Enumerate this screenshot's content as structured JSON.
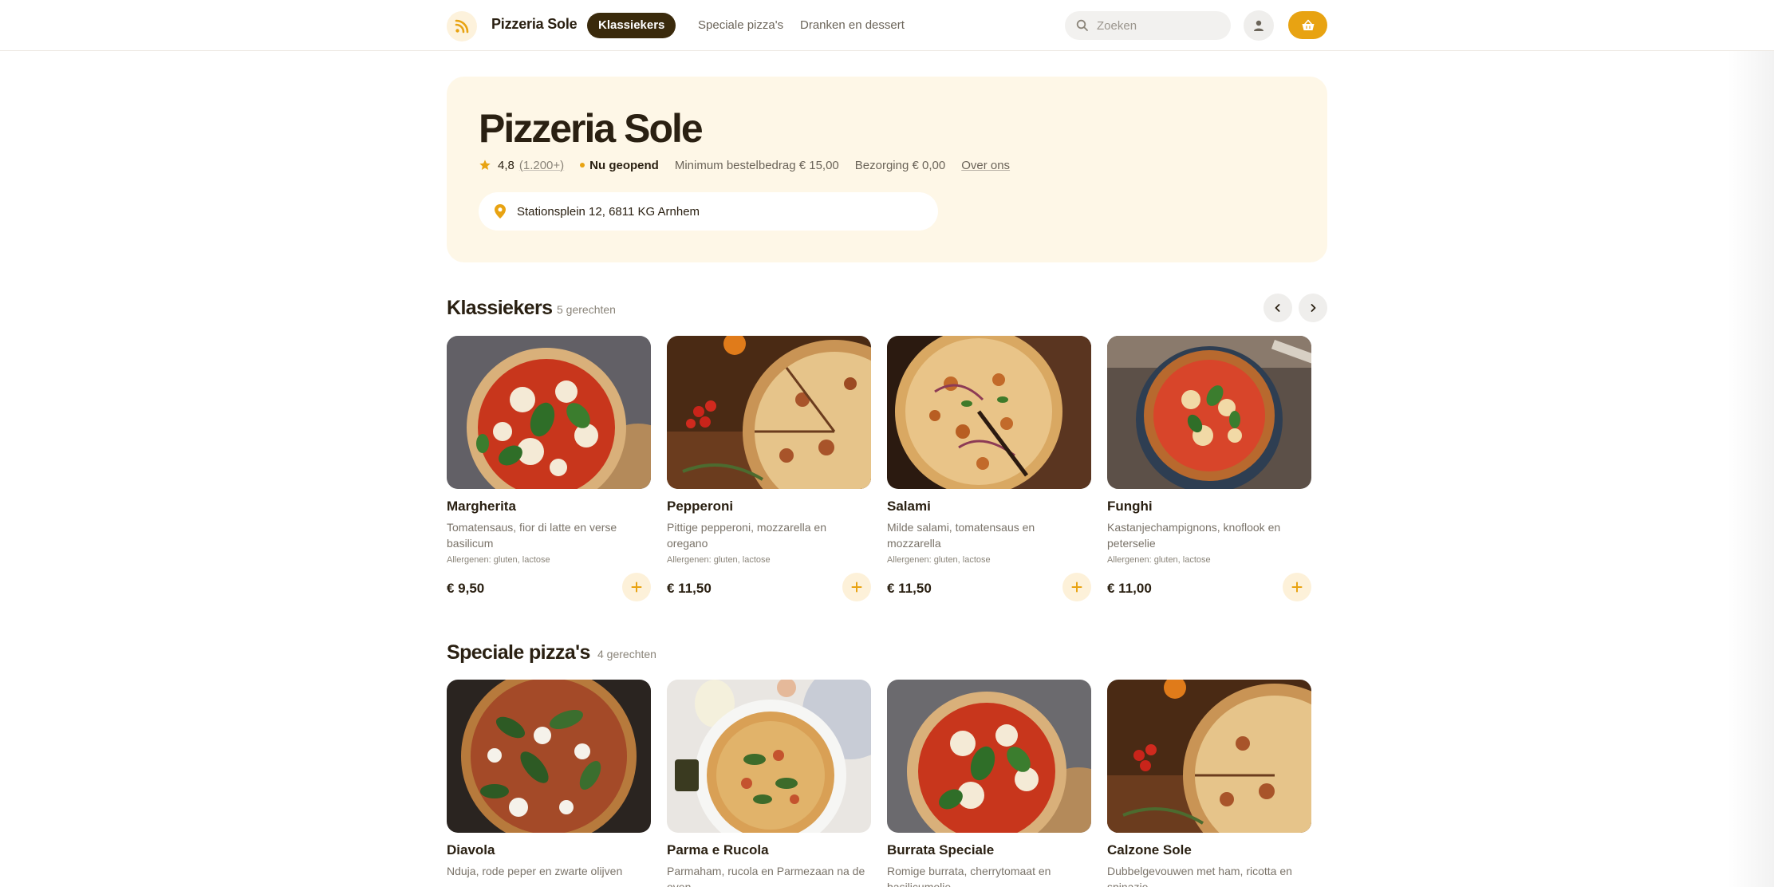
{
  "header": {
    "brand": "Pizzeria Sole",
    "nav": [
      "Klassiekers",
      "Speciale pizza's",
      "Dranken en dessert"
    ],
    "search_placeholder": "Zoeken"
  },
  "hero": {
    "title": "Pizzeria Sole",
    "rating": "4,8",
    "rating_count": "(1.200+)",
    "status": "Nu geopend",
    "min_order": "Minimum bestelbedrag € 15,00",
    "delivery": "Bezorging € 0,00",
    "about": "Over ons",
    "address": "Stationsplein 12, 6811 KG Arnhem"
  },
  "sections": [
    {
      "title": "Klassiekers",
      "count": "5 gerechten",
      "items": [
        {
          "name": "Margherita",
          "desc": "Tomatensaus, fior di latte en verse basilicum",
          "allergens": "Allergenen: gluten, lactose",
          "price": "€ 9,50"
        },
        {
          "name": "Pepperoni",
          "desc": "Pittige pepperoni, mozzarella en oregano",
          "allergens": "Allergenen: gluten, lactose",
          "price": "€ 11,50"
        },
        {
          "name": "Salami",
          "desc": "Milde salami, tomatensaus en mozzarella",
          "allergens": "Allergenen: gluten, lactose",
          "price": "€ 11,50"
        },
        {
          "name": "Funghi",
          "desc": "Kastanjechampignons, knoflook en peterselie",
          "allergens": "Allergenen: gluten, lactose",
          "price": "€ 11,00"
        }
      ]
    },
    {
      "title": "Speciale pizza's",
      "count": "4 gerechten",
      "items": [
        {
          "name": "Diavola",
          "desc": "Nduja, rode peper en zwarte olijven"
        },
        {
          "name": "Parma e Rucola",
          "desc": "Parmaham, rucola en Parmezaan na de oven"
        },
        {
          "name": "Burrata Speciale",
          "desc": "Romige burrata, cherrytomaat en basilicumolie"
        },
        {
          "name": "Calzone Sole",
          "desc": "Dubbelgevouwen met ham, ricotta en spinazie"
        }
      ]
    }
  ],
  "colors": {
    "accent": "#e8a312",
    "dark": "#2a2012",
    "hero_bg": "#fef7e7",
    "nav_active": "#3a2a0c"
  },
  "icons": [
    "logo-icon",
    "search-icon",
    "user-icon",
    "basket-icon",
    "star-icon",
    "location-pin-icon",
    "chevron-left-icon",
    "chevron-right-icon",
    "plus-icon"
  ]
}
